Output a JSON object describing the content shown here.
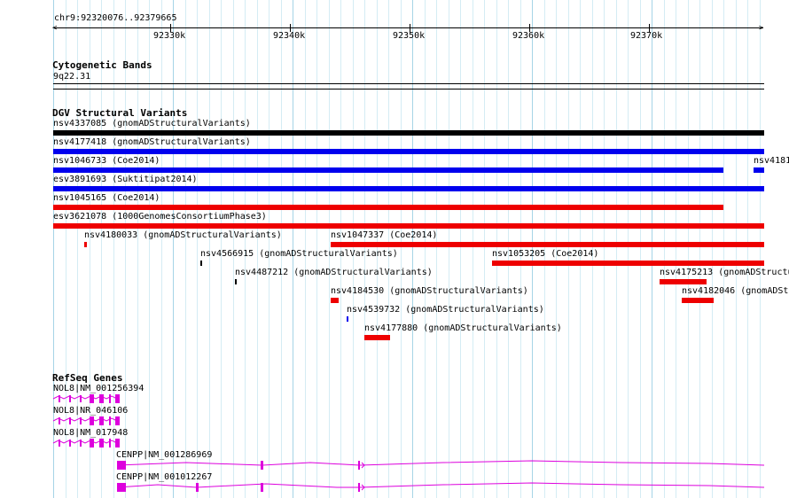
{
  "ruler": {
    "location": "chr9:92320076..92379665",
    "ticks": [
      "92330k",
      "92340k",
      "92350k",
      "92360k",
      "92370k"
    ]
  },
  "cytoband": {
    "title": "Cytogenetic Bands",
    "band": "9q22.31"
  },
  "dgv": {
    "title": "DGV Structural Variants",
    "features": [
      {
        "label": "nsv4337085 (gnomADStructuralVariants)",
        "color": "#000000"
      },
      {
        "label": "nsv4177418 (gnomADStructuralVariants)",
        "color": "#0000ee"
      },
      {
        "label": "nsv1046733 (Coe2014)",
        "color": "#0000ee"
      },
      {
        "label": "nsv4181",
        "color": "#0000ee"
      },
      {
        "label": "esv3891693 (Suktitipat2014)",
        "color": "#0000ee"
      },
      {
        "label": "nsv1045165 (Coe2014)",
        "color": "#ee0000"
      },
      {
        "label": "esv3621078 (1000GenomesConsortiumPhase3)",
        "color": "#ee0000"
      },
      {
        "label": "nsv4180033 (gnomADStructuralVariants)",
        "color": "#ee0000"
      },
      {
        "label": "nsv1047337 (Coe2014)",
        "color": "#ee0000"
      },
      {
        "label": "nsv4566915 (gnomADStructuralVariants)",
        "color": "#000000"
      },
      {
        "label": "nsv1053205 (Coe2014)",
        "color": "#ee0000"
      },
      {
        "label": "nsv4487212 (gnomADStructuralVariants)",
        "color": "#000000"
      },
      {
        "label": "nsv4175213 (gnomADStructu",
        "color": "#ee0000"
      },
      {
        "label": "nsv4184530 (gnomADStructuralVariants)",
        "color": "#ee0000"
      },
      {
        "label": "nsv4182046 (gnomADStr",
        "color": "#ee0000"
      },
      {
        "label": "nsv4539732 (gnomADStructuralVariants)",
        "color": "#0000ee"
      },
      {
        "label": "nsv4177880 (gnomADStructuralVariants)",
        "color": "#ee0000"
      }
    ]
  },
  "refseq": {
    "title": "RefSeq Genes",
    "genes": [
      {
        "label": "NOL8|NM_001256394"
      },
      {
        "label": "NOL8|NR_046106"
      },
      {
        "label": "NOL8|NM_017948"
      },
      {
        "label": "CENPP|NM_001286969"
      },
      {
        "label": "CENPP|NM_001012267"
      }
    ],
    "color": "#dd00dd"
  },
  "colors": {
    "grid_minor": "#d4ecf4",
    "grid_major": "#a6d4e6"
  }
}
